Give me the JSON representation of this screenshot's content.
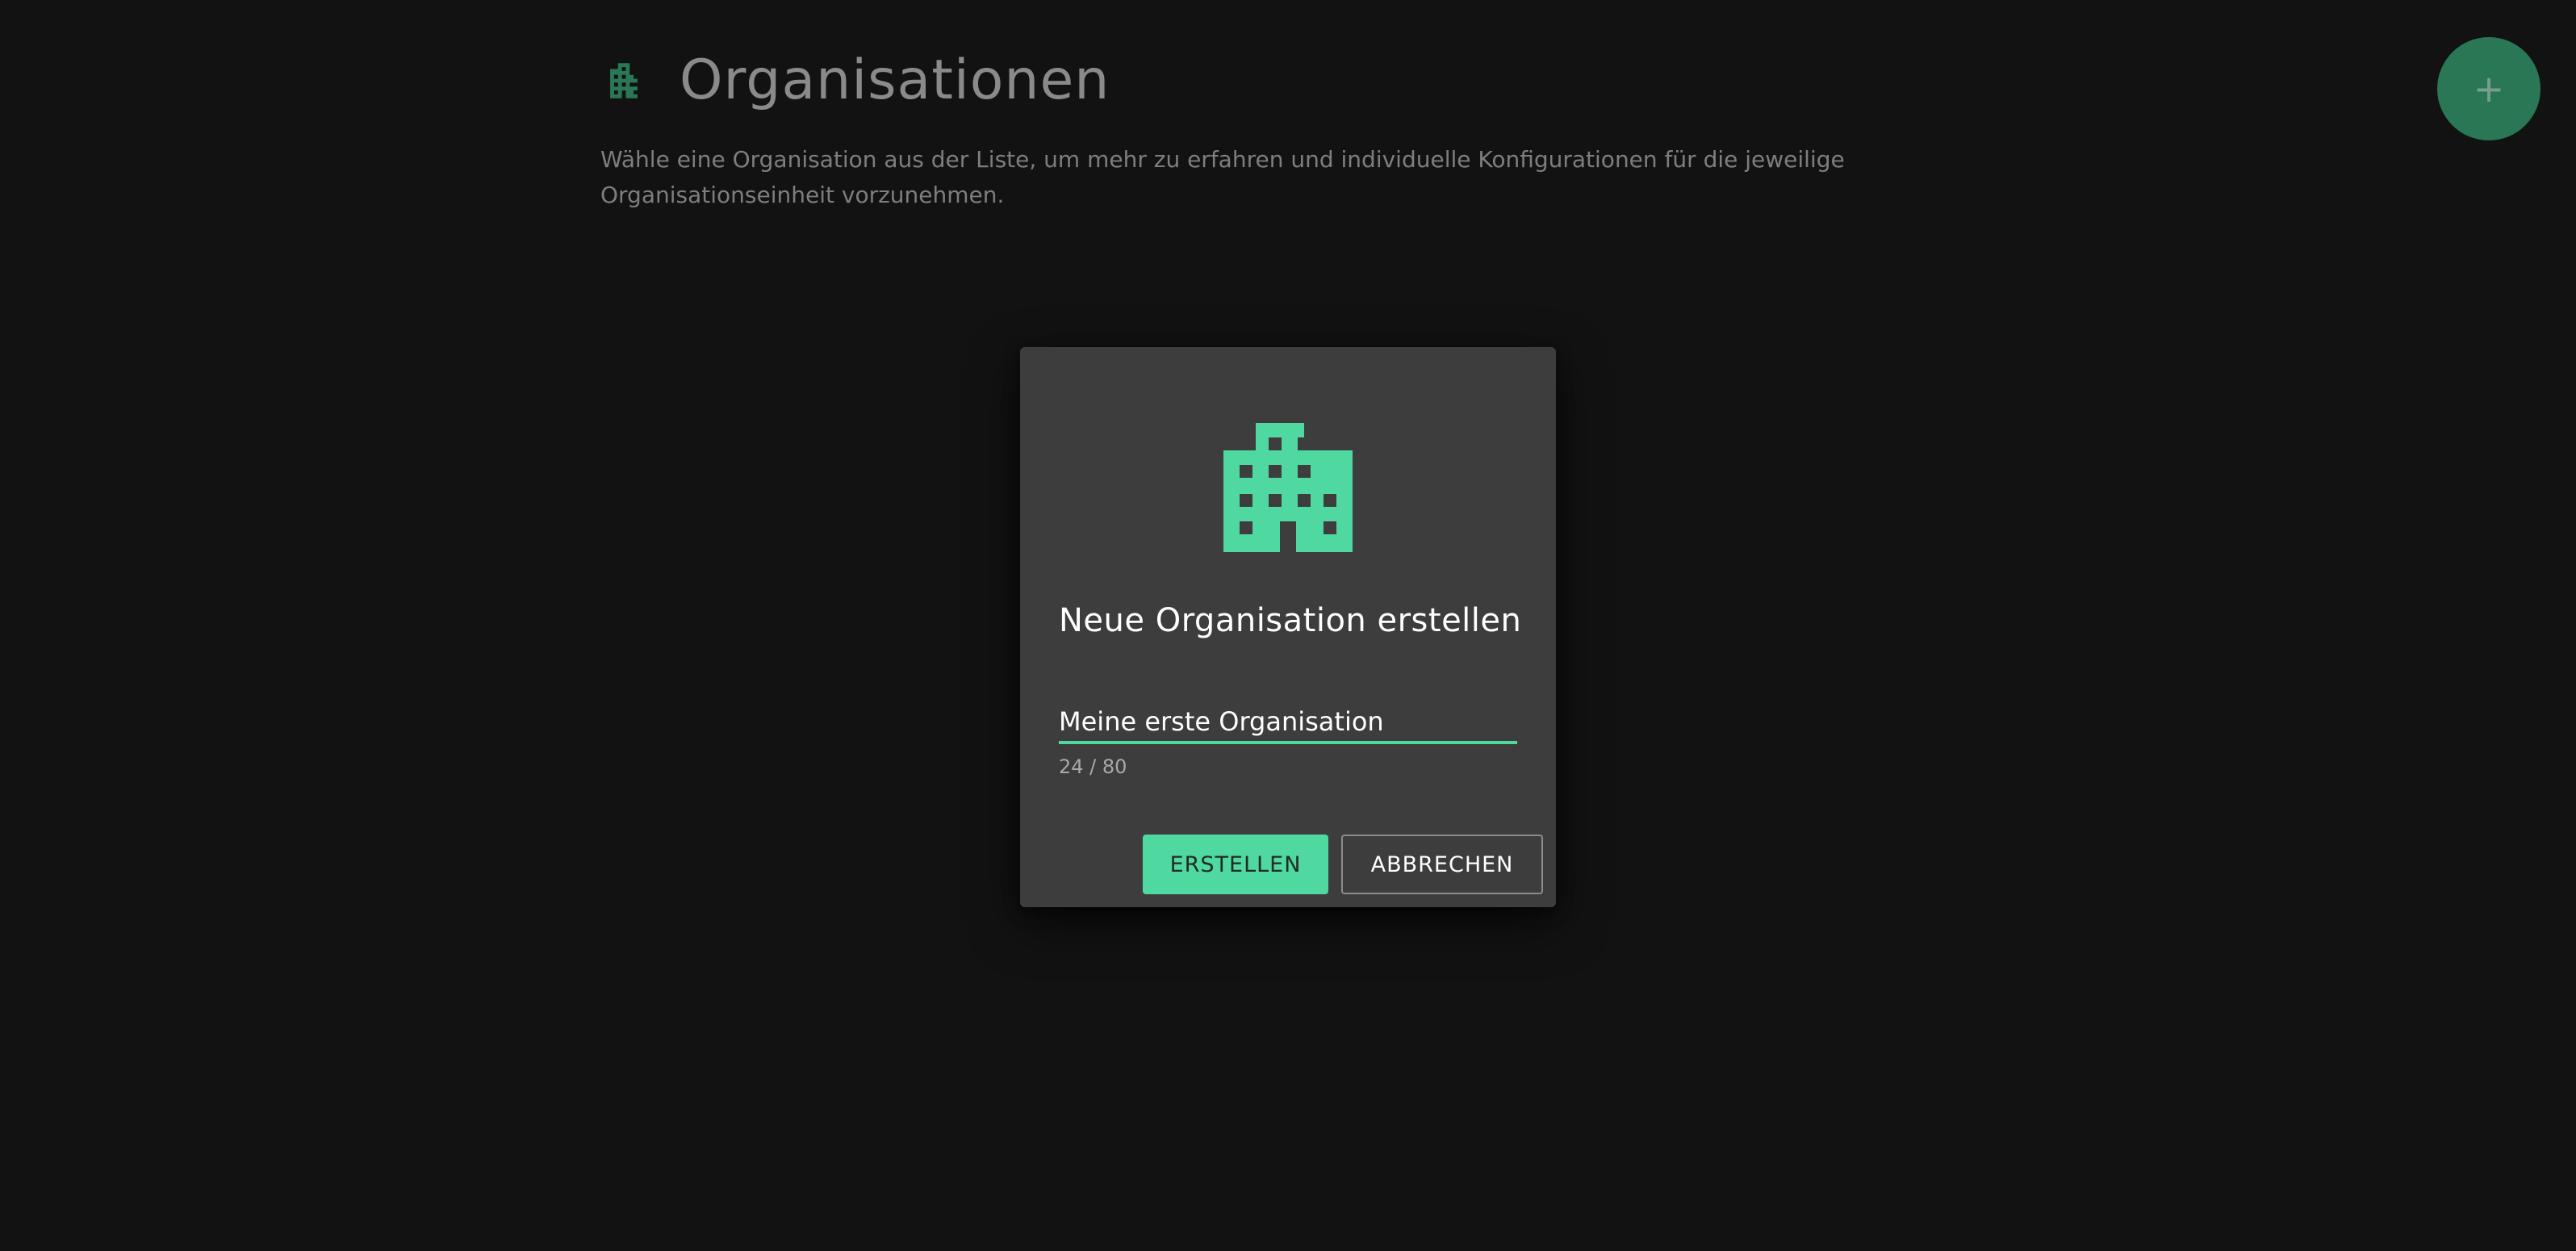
{
  "header": {
    "icon": "building-icon",
    "title": "Organisationen",
    "description": "Wähle eine Organisation aus der Liste, um mehr zu erfahren und individuelle Konfigurationen für die jeweilige Organisationseinheit vorzunehmen."
  },
  "fab": {
    "icon": "plus-icon",
    "label": "+"
  },
  "dialog": {
    "icon": "building-icon",
    "title": "Neue Organisation erstellen",
    "input_value": "Meine erste Organisation",
    "counter": "24 / 80",
    "create_label": "ERSTELLEN",
    "cancel_label": "ABBRECHEN"
  },
  "colors": {
    "accent": "#4fd8a0",
    "fab": "#2a7755",
    "dialog_bg": "#3d3d3d",
    "page_bg": "#121212"
  }
}
